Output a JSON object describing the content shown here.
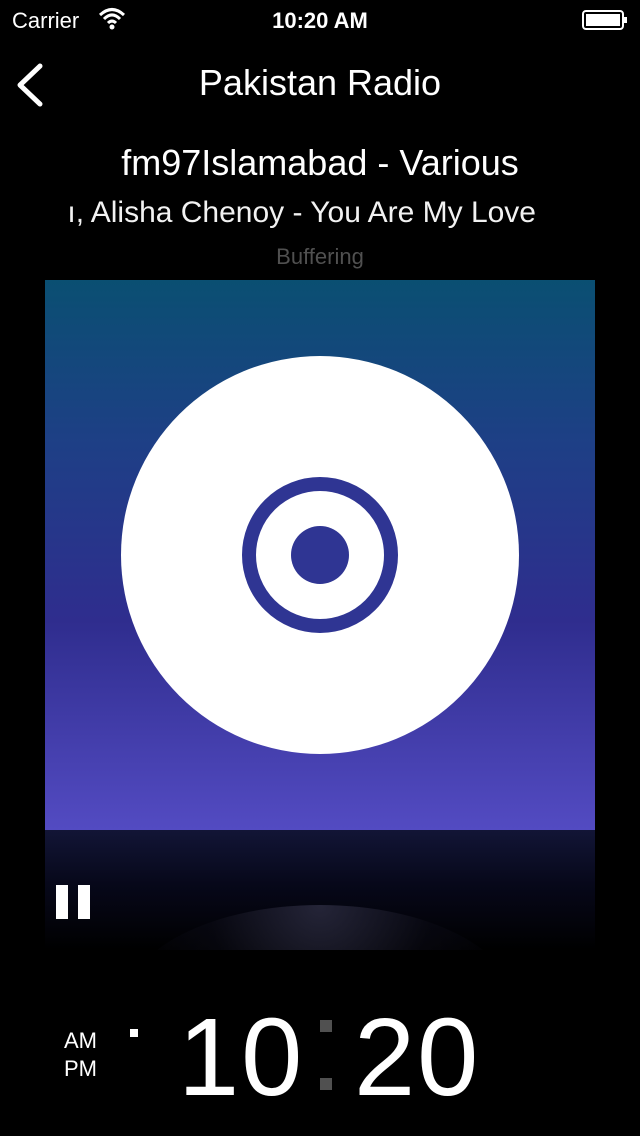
{
  "status_bar": {
    "carrier": "Carrier",
    "time": "10:20 AM",
    "wifi_icon": "wifi-icon",
    "battery_icon": "battery-icon"
  },
  "nav": {
    "title": "Pakistan Radio",
    "back_icon": "chevron-left-icon"
  },
  "now_playing": {
    "station": "fm97Islamabad - Various",
    "track": "ı, Alisha Chenoy - You Are My Love",
    "status": "Buffering"
  },
  "artwork": {
    "icon": "disc-icon",
    "colors": {
      "top": "#0a4f72",
      "bottom": "#534bc2",
      "disc": "#ffffff",
      "ring": "#2f3593"
    }
  },
  "controls": {
    "pause_icon": "pause-icon"
  },
  "big_clock": {
    "am": "AM",
    "pm": "PM",
    "hour": "10",
    "minute": "20"
  }
}
